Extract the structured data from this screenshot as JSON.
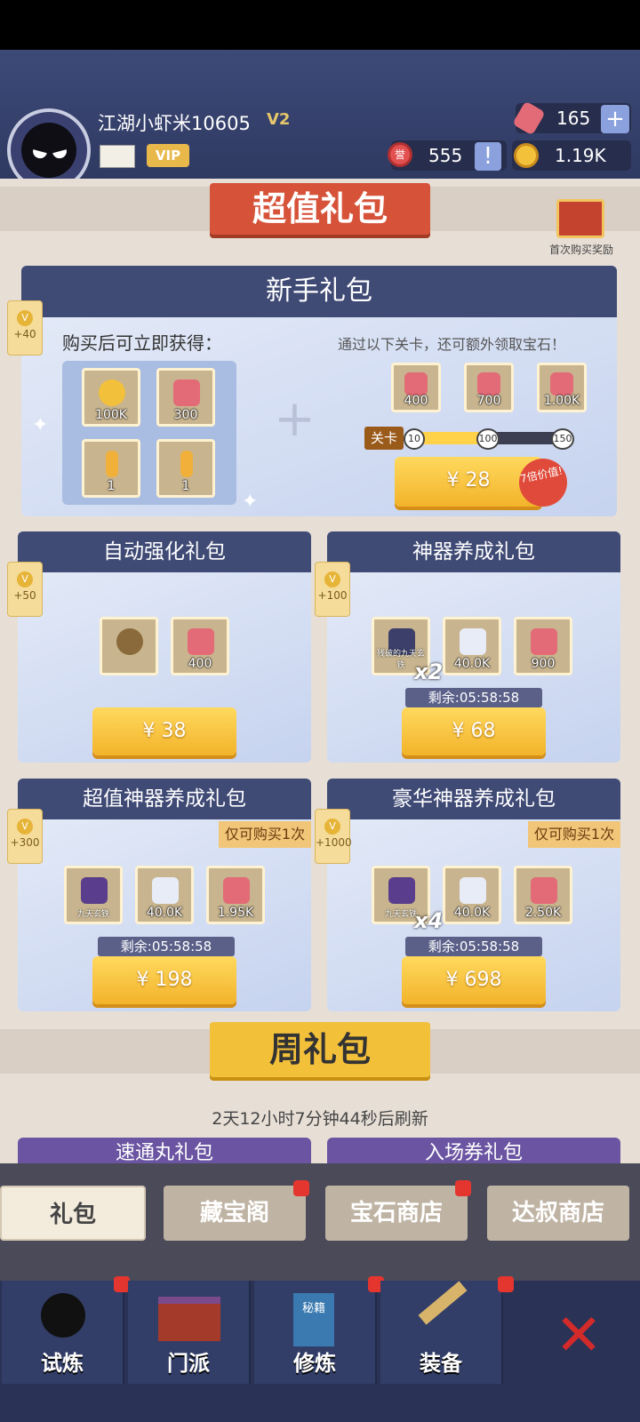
{
  "player": {
    "name": "江湖小虾米10605",
    "vip_level": "V2",
    "vip_label": "VIP"
  },
  "resources": {
    "gems": "165",
    "honor": "555",
    "gold": "1.19K",
    "honor_glyph": "誉",
    "add": "+",
    "alert": "!"
  },
  "banner_title": "超值礼包",
  "first_reward_label": "首次购买奖励",
  "newbie": {
    "title": "新手礼包",
    "vip_points": "+40",
    "instant_label": "购买后可立即获得：",
    "items": [
      "100K",
      "300",
      "1",
      "1"
    ],
    "extra_label": "通过以下关卡，还可额外领取宝石！",
    "extra_items": [
      "400",
      "700",
      "1.00K"
    ],
    "level_label": "关卡",
    "levels": [
      "10",
      "100",
      "150"
    ],
    "level_progress": 0.5,
    "price": "¥ 28",
    "badge": "7倍价值!"
  },
  "auto": {
    "title": "自动强化礼包",
    "vip_points": "+50",
    "items": [
      "400"
    ],
    "price": "¥ 38"
  },
  "artifact": {
    "title": "神器养成礼包",
    "vip_points": "+100",
    "items": [
      "残破的九天玄铁",
      "40.0K",
      "900"
    ],
    "multiplier": "x2",
    "timer": "剩余:05:58:58",
    "price": "¥ 68"
  },
  "super": {
    "title": "超值神器养成礼包",
    "vip_points": "+300",
    "limit": "仅可购买1次",
    "items": [
      "九天玄铁",
      "40.0K",
      "1.95K"
    ],
    "timer": "剩余:05:58:58",
    "price": "¥ 198"
  },
  "luxury": {
    "title": "豪华神器养成礼包",
    "vip_points": "+1000",
    "limit": "仅可购买1次",
    "items": [
      "九天玄铁",
      "40.0K",
      "2.50K"
    ],
    "multiplier": "x4",
    "timer": "剩余:05:58:58",
    "price": "¥ 698"
  },
  "weekly": {
    "title": "周礼包",
    "refresh": "2天12小时7分钟44秒后刷新",
    "pack1": "速通丸礼包",
    "pack2": "入场券礼包"
  },
  "shop_tabs": [
    "礼包",
    "藏宝阁",
    "宝石商店",
    "达叔商店"
  ],
  "nav": [
    "试炼",
    "门派",
    "修炼",
    "装备"
  ],
  "book_glyph": "秘籍",
  "vip_glyph": "V",
  "colors": {
    "accent": "#f2b32a",
    "header": "#3f4a75",
    "banner": "#d6533a"
  }
}
